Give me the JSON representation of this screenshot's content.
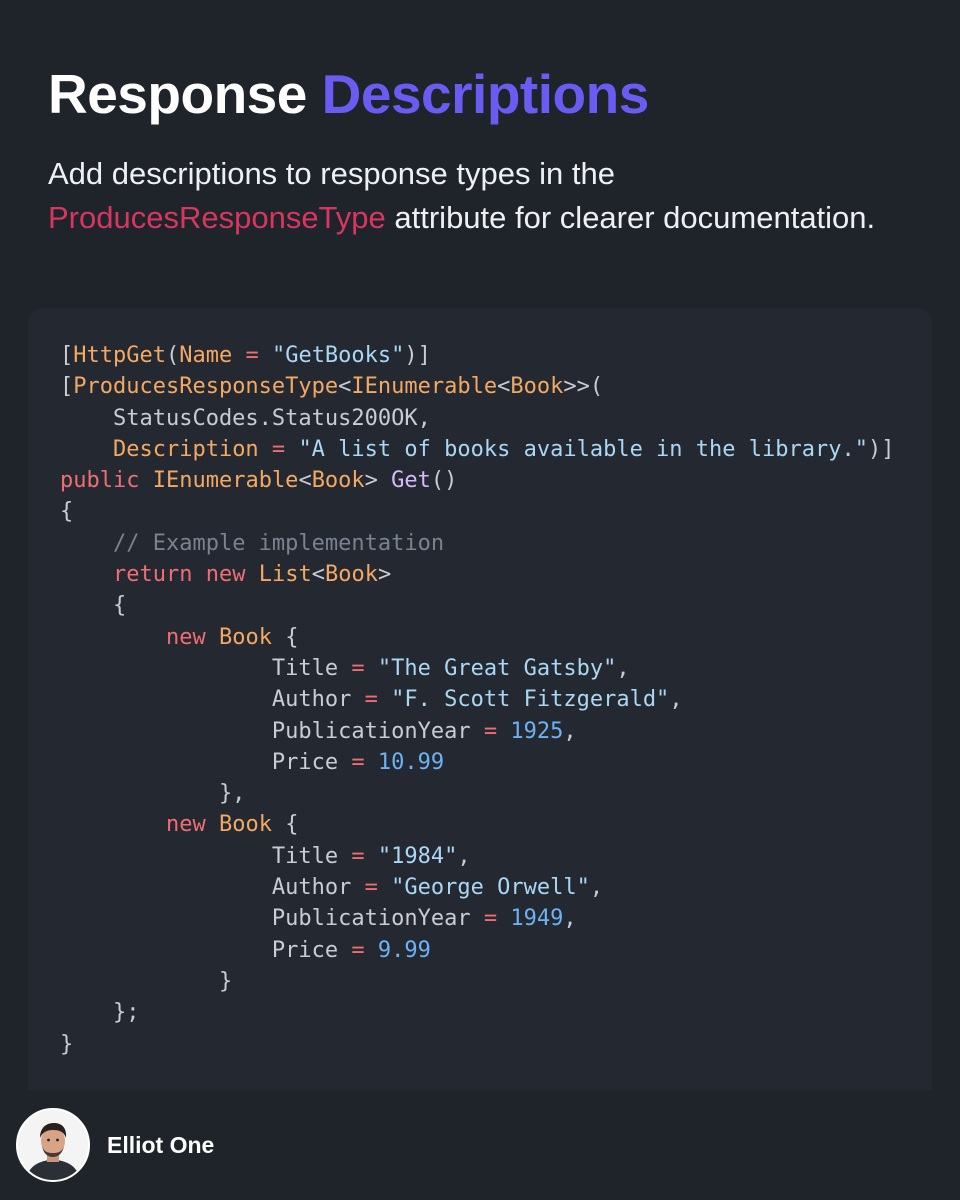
{
  "header": {
    "title_primary": "Response",
    "title_accent": "Descriptions",
    "subtitle_before": "Add descriptions to response types in the",
    "subtitle_code_ref": "ProducesResponseType",
    "subtitle_after": "attribute for clearer documentation."
  },
  "colors": {
    "background": "#1f232a",
    "code_panel": "#242830",
    "title_accent": "#6a5cf2",
    "code_ref": "#d8365f"
  },
  "code_lines": [
    [
      [
        "plain",
        "["
      ],
      [
        "type",
        "HttpGet"
      ],
      [
        "plain",
        "("
      ],
      [
        "type",
        "Name"
      ],
      [
        "operator",
        " = "
      ],
      [
        "string",
        "\"GetBooks\""
      ],
      [
        "plain",
        ")]"
      ]
    ],
    [
      [
        "plain",
        "["
      ],
      [
        "type",
        "ProducesResponseType"
      ],
      [
        "plain",
        "<"
      ],
      [
        "type",
        "IEnumerable"
      ],
      [
        "plain",
        "<"
      ],
      [
        "type",
        "Book"
      ],
      [
        "plain",
        ">>("
      ]
    ],
    [
      [
        "plain",
        "    StatusCodes.Status200OK,"
      ]
    ],
    [
      [
        "plain",
        "    "
      ],
      [
        "type",
        "Description"
      ],
      [
        "operator",
        " = "
      ],
      [
        "string",
        "\"A list of books available in the library.\""
      ],
      [
        "plain",
        ")]"
      ]
    ],
    [
      [
        "keyword",
        "public"
      ],
      [
        "plain",
        " "
      ],
      [
        "type",
        "IEnumerable"
      ],
      [
        "plain",
        "<"
      ],
      [
        "type",
        "Book"
      ],
      [
        "plain",
        "> "
      ],
      [
        "method",
        "Get"
      ],
      [
        "plain",
        "()"
      ]
    ],
    [
      [
        "plain",
        "{"
      ]
    ],
    [
      [
        "plain",
        "    "
      ],
      [
        "comment",
        "// Example implementation"
      ]
    ],
    [
      [
        "plain",
        "    "
      ],
      [
        "keyword",
        "return"
      ],
      [
        "plain",
        " "
      ],
      [
        "keyword",
        "new"
      ],
      [
        "plain",
        " "
      ],
      [
        "type",
        "List"
      ],
      [
        "plain",
        "<"
      ],
      [
        "type",
        "Book"
      ],
      [
        "plain",
        ">"
      ]
    ],
    [
      [
        "plain",
        "    {"
      ]
    ],
    [
      [
        "plain",
        "        "
      ],
      [
        "keyword",
        "new"
      ],
      [
        "plain",
        " "
      ],
      [
        "type",
        "Book"
      ],
      [
        "plain",
        " {"
      ]
    ],
    [
      [
        "plain",
        "                "
      ],
      [
        "plain",
        "Title"
      ],
      [
        "operator",
        " = "
      ],
      [
        "string",
        "\"The Great Gatsby\""
      ],
      [
        "plain",
        ","
      ]
    ],
    [
      [
        "plain",
        "                "
      ],
      [
        "plain",
        "Author"
      ],
      [
        "operator",
        " = "
      ],
      [
        "string",
        "\"F. Scott Fitzgerald\""
      ],
      [
        "plain",
        ","
      ]
    ],
    [
      [
        "plain",
        "                "
      ],
      [
        "plain",
        "PublicationYear"
      ],
      [
        "operator",
        " = "
      ],
      [
        "number",
        "1925"
      ],
      [
        "plain",
        ","
      ]
    ],
    [
      [
        "plain",
        "                "
      ],
      [
        "plain",
        "Price"
      ],
      [
        "operator",
        " = "
      ],
      [
        "number",
        "10.99"
      ]
    ],
    [
      [
        "plain",
        "            },"
      ]
    ],
    [
      [
        "plain",
        "        "
      ],
      [
        "keyword",
        "new"
      ],
      [
        "plain",
        " "
      ],
      [
        "type",
        "Book"
      ],
      [
        "plain",
        " {"
      ]
    ],
    [
      [
        "plain",
        "                "
      ],
      [
        "plain",
        "Title"
      ],
      [
        "operator",
        " = "
      ],
      [
        "string",
        "\"1984\""
      ],
      [
        "plain",
        ","
      ]
    ],
    [
      [
        "plain",
        "                "
      ],
      [
        "plain",
        "Author"
      ],
      [
        "operator",
        " = "
      ],
      [
        "string",
        "\"George Orwell\""
      ],
      [
        "plain",
        ","
      ]
    ],
    [
      [
        "plain",
        "                "
      ],
      [
        "plain",
        "PublicationYear"
      ],
      [
        "operator",
        " = "
      ],
      [
        "number",
        "1949"
      ],
      [
        "plain",
        ","
      ]
    ],
    [
      [
        "plain",
        "                "
      ],
      [
        "plain",
        "Price"
      ],
      [
        "operator",
        " = "
      ],
      [
        "number",
        "9.99"
      ]
    ],
    [
      [
        "plain",
        "            }"
      ]
    ],
    [
      [
        "plain",
        "    };"
      ]
    ],
    [
      [
        "plain",
        "}"
      ]
    ]
  ],
  "author": {
    "name": "Elliot One",
    "avatar_icon": "person-photo-icon"
  }
}
